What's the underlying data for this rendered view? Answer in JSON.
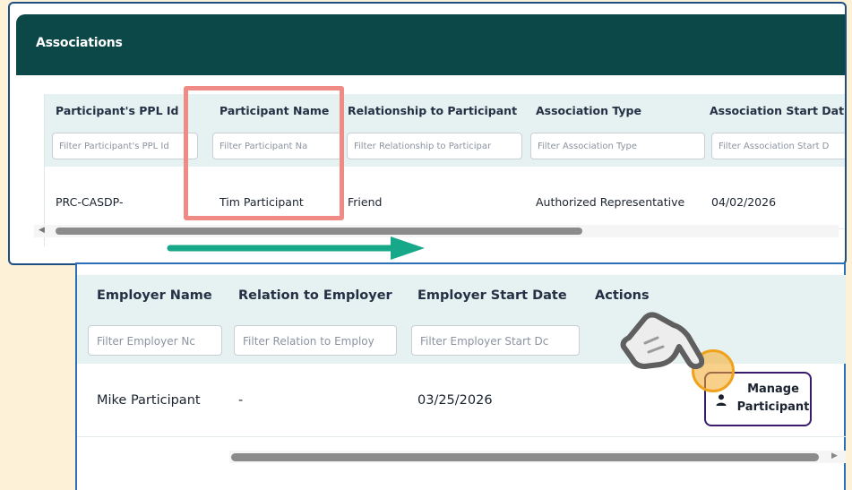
{
  "associations": {
    "title": "Associations",
    "columns": [
      "Participant's PPL Id",
      "Participant Name",
      "Relationship to Participant",
      "Association Type",
      "Association Start Dat"
    ],
    "filters": [
      "Filter Participant's PPL Id",
      "Filter Participant Na",
      "Filter Relationship to Participar",
      "Filter Association Type",
      "Filter Association Start D"
    ],
    "row": {
      "ppl_id": "PRC-CASDP-",
      "participant_name": "Tim Participant",
      "relationship": "Friend",
      "association_type": "Authorized Representative",
      "start_date": "04/02/2026"
    }
  },
  "employer": {
    "columns": [
      "Employer Name",
      "Relation to Employer",
      "Employer Start Date",
      "Actions"
    ],
    "filters": [
      "Filter Employer Nc",
      "Filter Relation to Employ",
      "Filter Employer Start Dc"
    ],
    "row": {
      "employer_name": "Mike Participant",
      "relation": "-",
      "start_date": "03/25/2026"
    },
    "manage_button": {
      "line1": "Manage",
      "line2": "Participant",
      "icon": "person-icon"
    }
  },
  "colors": {
    "header_bg": "#0d4848",
    "highlight": "#f08a85",
    "arrow": "#17a88a",
    "button_border": "#3a1b6e",
    "click_ring": "#f0a21c",
    "page_bg": "#fdf1d8"
  }
}
